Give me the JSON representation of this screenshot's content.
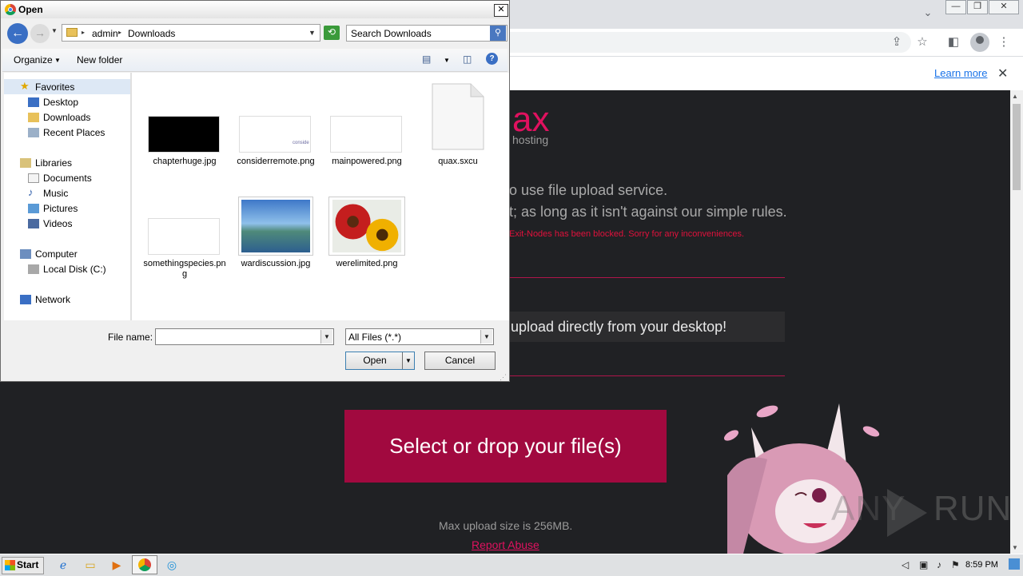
{
  "browser": {
    "window_controls": [
      "—",
      "❐",
      "✕"
    ],
    "learn_more": "Learn more",
    "page": {
      "logo": "ax",
      "logo_sub": "hosting",
      "line1": "o use file upload service.",
      "line2": "t; as long as it isn't against our simple rules.",
      "warning": "Exit-Nodes has been blocked. Sorry for any inconveniences.",
      "banner": "upload directly from your desktop!",
      "drop_button": "Select or drop your file(s)",
      "max_upload": "Max upload size is 256MB.",
      "report_abuse": "Report Abuse",
      "watermark": "RUN",
      "watermark_any": "ANY"
    }
  },
  "dialog": {
    "title": "Open",
    "breadcrumb": [
      "admin",
      "Downloads"
    ],
    "search_placeholder": "Search Downloads",
    "toolbar": {
      "organize": "Organize",
      "new_folder": "New folder"
    },
    "nav": {
      "favorites": "Favorites",
      "desktop": "Desktop",
      "downloads": "Downloads",
      "recent": "Recent Places",
      "libraries": "Libraries",
      "documents": "Documents",
      "music": "Music",
      "pictures": "Pictures",
      "videos": "Videos",
      "computer": "Computer",
      "local_disk": "Local Disk (C:)",
      "network": "Network"
    },
    "files": [
      {
        "name": "chapterhuge.jpg"
      },
      {
        "name": "considerremote.png",
        "thumb_text": "conside"
      },
      {
        "name": "mainpowered.png"
      },
      {
        "name": "quax.sxcu"
      },
      {
        "name": "somethingspecies.png"
      },
      {
        "name": "wardiscussion.jpg"
      },
      {
        "name": "werelimited.png"
      }
    ],
    "file_name_label": "File name:",
    "file_name_value": "",
    "filter": "All Files (*.*)",
    "open_button": "Open",
    "cancel_button": "Cancel"
  },
  "taskbar": {
    "start": "Start",
    "clock": "8:59 PM"
  },
  "colors": {
    "accent": "#e0115f",
    "drop_button_bg": "#a1093f",
    "page_bg": "#202124"
  }
}
